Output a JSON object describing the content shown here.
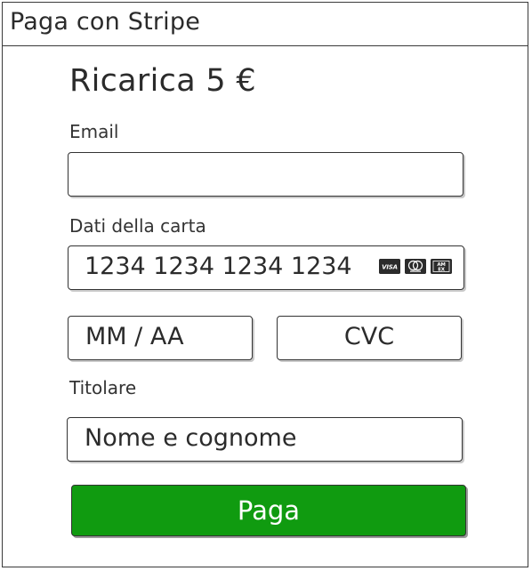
{
  "window": {
    "title": "Paga con Stripe"
  },
  "form": {
    "heading": "Ricarica 5 €",
    "email_label": "Email",
    "email_value": "",
    "card_label": "Dati della carta",
    "card_number_placeholder": "1234 1234 1234 1234",
    "card_brand_icons": [
      "visa-icon",
      "mastercard-icon",
      "amex-icon"
    ],
    "expiry_placeholder": "MM / AA",
    "cvc_placeholder": "CVC",
    "holder_label": "Titolare",
    "holder_placeholder": "Nome e cognome",
    "pay_button_label": "Paga"
  },
  "colors": {
    "pay_button": "#109b10",
    "border": "#333333"
  }
}
